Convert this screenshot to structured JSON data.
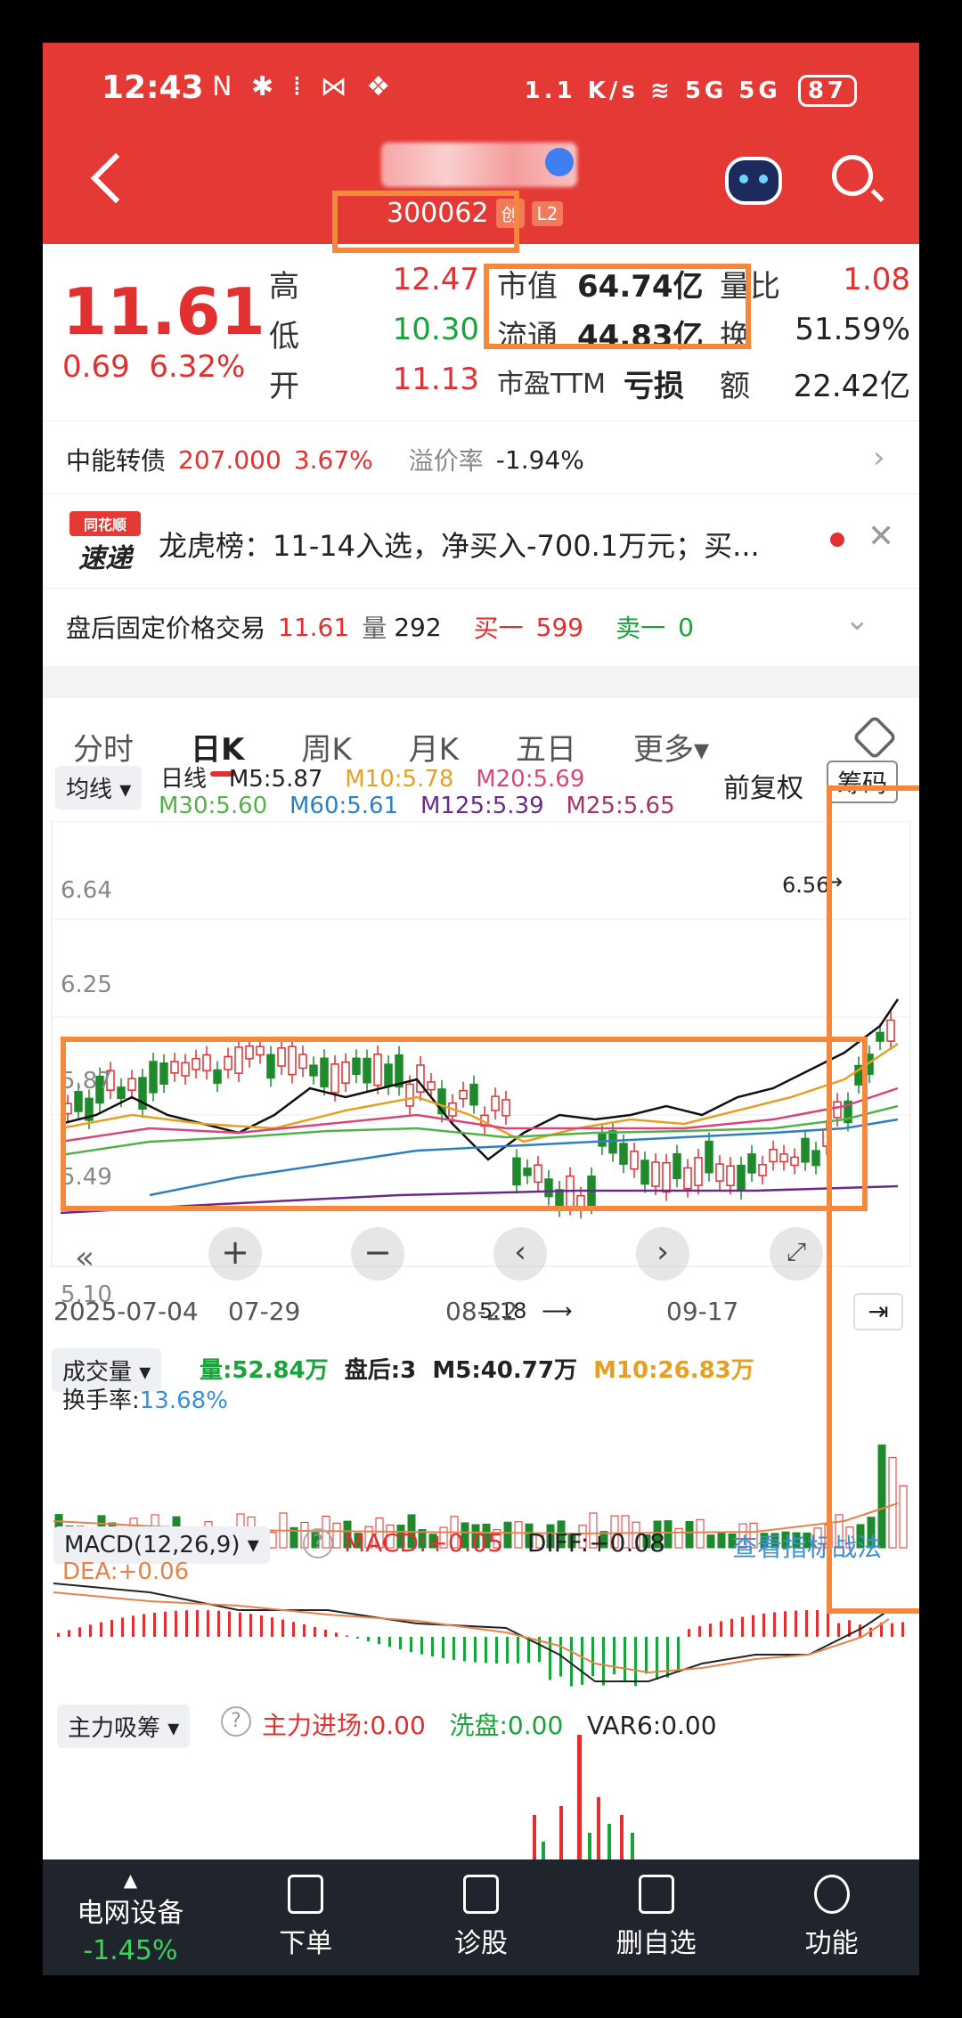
{
  "status_bar": {
    "time": "12:43",
    "left_icons": "N ✱ ⁞ ⋈ ❖",
    "net_speed": "1.1 K/s",
    "signal": "5G 5G",
    "battery": "87"
  },
  "header": {
    "code": "300062",
    "badge_chuang": "创",
    "badge_l2": "L2"
  },
  "quote": {
    "price": "11.61",
    "change": "0.69",
    "change_pct": "6.32%",
    "high_label": "高",
    "high": "12.47",
    "low_label": "低",
    "low": "10.30",
    "open_label": "开",
    "open": "11.13",
    "mktcap_label": "市值",
    "mktcap": "64.74亿",
    "float_label": "流通",
    "float": "44.83亿",
    "pe_label": "市盈TTM",
    "pe": "亏损",
    "volratio_label": "量比",
    "volratio": "1.08",
    "turnover_label": "换",
    "turnover": "51.59%",
    "amount_label": "额",
    "amount": "22.42亿"
  },
  "bond": {
    "name": "中能转债",
    "price": "207.000",
    "pct": "3.67%",
    "premium_label": "溢价率",
    "premium": "-1.94%"
  },
  "news": {
    "logo_top": "同花顺",
    "logo_bottom": "速递",
    "text": "龙虎榜：11-14入选，净买入-700.1万元；买..."
  },
  "after_hours": {
    "label": "盘后固定价格交易",
    "price": "11.61",
    "vol_label": "量",
    "vol": "292",
    "buy_label": "买一",
    "buy": "599",
    "sell_label": "卖一",
    "sell": "0"
  },
  "tabs": [
    "分时",
    "日K",
    "周K",
    "月K",
    "五日",
    "更多▾"
  ],
  "kline": {
    "ma_button": "均线 ▾",
    "line_label": "日线",
    "m5": "M5:5.87",
    "m10": "M10:5.78",
    "m20": "M20:5.69",
    "m30": "M30:5.60",
    "m60": "M60:5.61",
    "m125": "M125:5.39",
    "m25": "M25:5.65",
    "fq": "前复权",
    "chip": "筹码",
    "y_ticks": [
      "6.64",
      "6.25",
      "5.87",
      "5.49",
      "5.10"
    ],
    "x_ticks": [
      "2025-07-04",
      "07-29",
      "08-22",
      "09-17"
    ],
    "high_mark": "6.56",
    "low_mark": "5.18"
  },
  "volume": {
    "button": "成交量 ▾",
    "vol": "量:52.84万",
    "after": "盘后:3",
    "m5": "M5:40.77万",
    "m10": "M10:26.83万",
    "turnover_label": "换手率:",
    "turnover": "13.68%"
  },
  "macd": {
    "button": "MACD(12,26,9) ▾",
    "macd": "MACD:+0.05",
    "diff": "DIFF:+0.08",
    "dea": "DEA:+0.06",
    "link": "查看指标战法"
  },
  "capital": {
    "button": "主力吸筹 ▾",
    "in": "主力进场:0.00",
    "wash": "洗盘:0.00",
    "var6": "VAR6:0.00"
  },
  "bottom_nav": {
    "sector": "电网设备",
    "sector_pct": "-1.45%",
    "order": "下单",
    "diagnose": "诊股",
    "delete": "删自选",
    "func": "功能"
  },
  "colors": {
    "red": "#e03030",
    "green": "#1aa33a",
    "accent": "#e53935",
    "annotation": "#f5883c"
  }
}
